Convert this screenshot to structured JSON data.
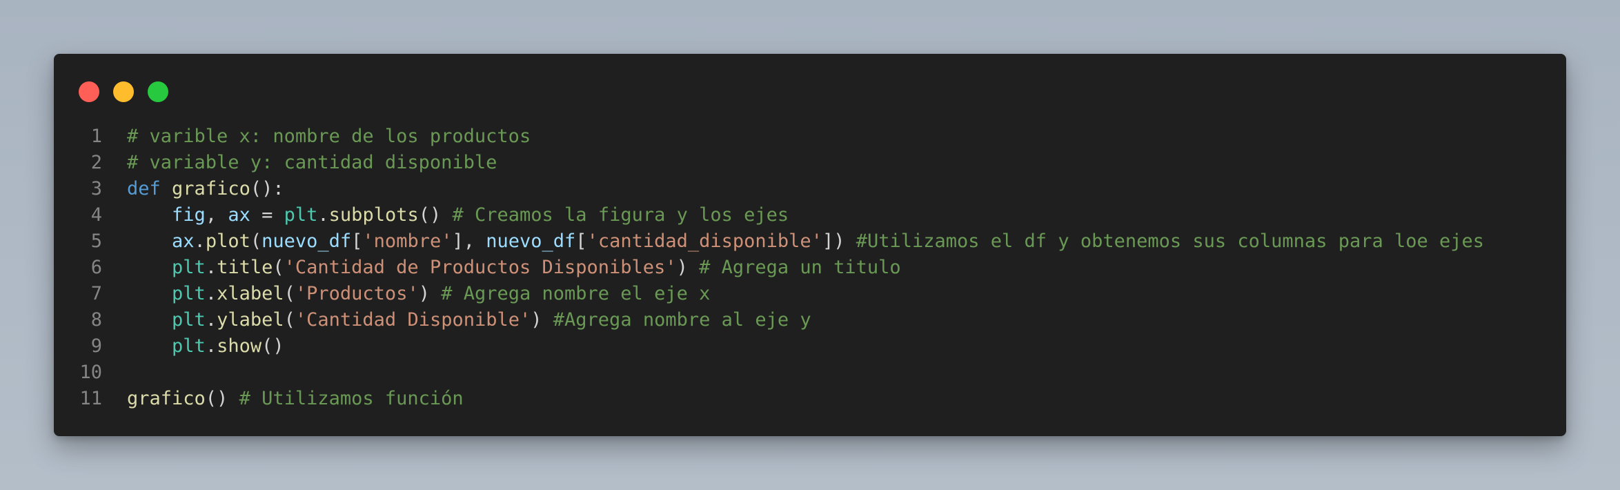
{
  "window": {
    "controls": [
      {
        "name": "close",
        "color": "#ff5f56"
      },
      {
        "name": "minimize",
        "color": "#ffbd2e"
      },
      {
        "name": "zoom",
        "color": "#27c93f"
      }
    ]
  },
  "colors": {
    "background": "#aeb8c4",
    "editor": "#1f1f1f",
    "keyword": "#569cd6",
    "function": "#dcdcaa",
    "variable": "#9cdcfe",
    "module": "#4ec9b0",
    "string": "#ce9178",
    "comment": "#6a9955",
    "line_number": "#858585"
  },
  "code": {
    "lines": [
      {
        "n": "1",
        "tokens": [
          {
            "t": "com",
            "v": "# varible x: nombre de los productos"
          }
        ]
      },
      {
        "n": "2",
        "tokens": [
          {
            "t": "com",
            "v": "# variable y: cantidad disponible"
          }
        ]
      },
      {
        "n": "3",
        "tokens": [
          {
            "t": "kw",
            "v": "def"
          },
          {
            "t": "pun",
            "v": " "
          },
          {
            "t": "fn",
            "v": "grafico"
          },
          {
            "t": "pun",
            "v": "():"
          }
        ]
      },
      {
        "n": "4",
        "tokens": [
          {
            "t": "pun",
            "v": "    "
          },
          {
            "t": "var",
            "v": "fig"
          },
          {
            "t": "pun",
            "v": ", "
          },
          {
            "t": "var",
            "v": "ax"
          },
          {
            "t": "pun",
            "v": " = "
          },
          {
            "t": "cls",
            "v": "plt"
          },
          {
            "t": "pun",
            "v": "."
          },
          {
            "t": "fn",
            "v": "subplots"
          },
          {
            "t": "pun",
            "v": "() "
          },
          {
            "t": "com",
            "v": "# Creamos la figura y los ejes"
          }
        ]
      },
      {
        "n": "5",
        "tokens": [
          {
            "t": "pun",
            "v": "    "
          },
          {
            "t": "var",
            "v": "ax"
          },
          {
            "t": "pun",
            "v": "."
          },
          {
            "t": "fn",
            "v": "plot"
          },
          {
            "t": "pun",
            "v": "("
          },
          {
            "t": "var",
            "v": "nuevo_df"
          },
          {
            "t": "pun",
            "v": "["
          },
          {
            "t": "str",
            "v": "'nombre'"
          },
          {
            "t": "pun",
            "v": "], "
          },
          {
            "t": "var",
            "v": "nuevo_df"
          },
          {
            "t": "pun",
            "v": "["
          },
          {
            "t": "str",
            "v": "'cantidad_disponible'"
          },
          {
            "t": "pun",
            "v": "]) "
          },
          {
            "t": "com",
            "v": "#Utilizamos el df y obtenemos sus columnas para loe ejes"
          }
        ]
      },
      {
        "n": "6",
        "tokens": [
          {
            "t": "pun",
            "v": "    "
          },
          {
            "t": "cls",
            "v": "plt"
          },
          {
            "t": "pun",
            "v": "."
          },
          {
            "t": "fn",
            "v": "title"
          },
          {
            "t": "pun",
            "v": "("
          },
          {
            "t": "str",
            "v": "'Cantidad de Productos Disponibles'"
          },
          {
            "t": "pun",
            "v": ") "
          },
          {
            "t": "com",
            "v": "# Agrega un titulo"
          }
        ]
      },
      {
        "n": "7",
        "tokens": [
          {
            "t": "pun",
            "v": "    "
          },
          {
            "t": "cls",
            "v": "plt"
          },
          {
            "t": "pun",
            "v": "."
          },
          {
            "t": "fn",
            "v": "xlabel"
          },
          {
            "t": "pun",
            "v": "("
          },
          {
            "t": "str",
            "v": "'Productos'"
          },
          {
            "t": "pun",
            "v": ") "
          },
          {
            "t": "com",
            "v": "# Agrega nombre el eje x"
          }
        ]
      },
      {
        "n": "8",
        "tokens": [
          {
            "t": "pun",
            "v": "    "
          },
          {
            "t": "cls",
            "v": "plt"
          },
          {
            "t": "pun",
            "v": "."
          },
          {
            "t": "fn",
            "v": "ylabel"
          },
          {
            "t": "pun",
            "v": "("
          },
          {
            "t": "str",
            "v": "'Cantidad Disponible'"
          },
          {
            "t": "pun",
            "v": ") "
          },
          {
            "t": "com",
            "v": "#Agrega nombre al eje y"
          }
        ]
      },
      {
        "n": "9",
        "tokens": [
          {
            "t": "pun",
            "v": "    "
          },
          {
            "t": "cls",
            "v": "plt"
          },
          {
            "t": "pun",
            "v": "."
          },
          {
            "t": "fn",
            "v": "show"
          },
          {
            "t": "pun",
            "v": "()"
          }
        ]
      },
      {
        "n": "10",
        "tokens": []
      },
      {
        "n": "11",
        "tokens": [
          {
            "t": "fn",
            "v": "grafico"
          },
          {
            "t": "pun",
            "v": "() "
          },
          {
            "t": "com",
            "v": "# Utilizamos función"
          }
        ]
      }
    ]
  }
}
